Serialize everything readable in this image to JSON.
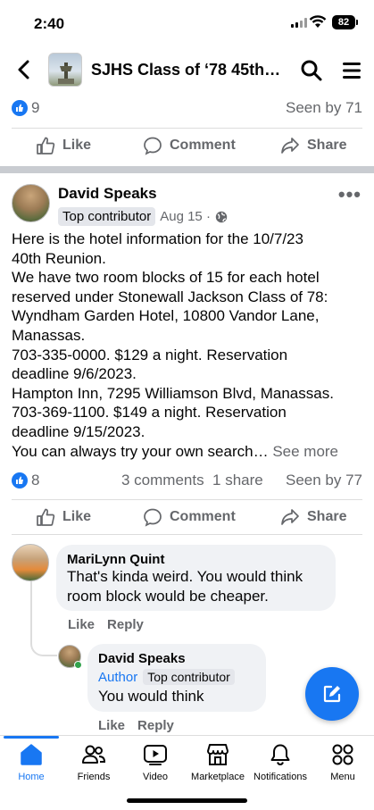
{
  "status_bar": {
    "time": "2:40",
    "battery": "82"
  },
  "header": {
    "group_title": "SJHS Class of ‘78 45th…"
  },
  "prev_post": {
    "reaction_count": "9",
    "seen_by": "Seen by 71",
    "actions": {
      "like": "Like",
      "comment": "Comment",
      "share": "Share"
    }
  },
  "post": {
    "author": "David Speaks",
    "badge": "Top contributor",
    "date": "Aug 15 ·",
    "body_lines": [
      "Here is the hotel information for the 10/7/23",
      "40th Reunion.",
      "We have two room blocks of 15 for each hotel",
      "reserved under Stonewall Jackson Class of 78:",
      "Wyndham Garden Hotel, 10800 Vandor Lane,",
      "Manassas.",
      "703-335-0000. $129 a night. Reservation",
      "deadline 9/6/2023.",
      "Hampton Inn, 7295 Williamson Blvd, Manassas.",
      "703-369-1100. $149 a night. Reservation",
      "deadline 9/15/2023."
    ],
    "last_line": "You can always try your own search…",
    "see_more": "See more",
    "reaction_count": "8",
    "comments": "3 comments",
    "shares": "1 share",
    "seen_by": "Seen by 77",
    "actions": {
      "like": "Like",
      "comment": "Comment",
      "share": "Share"
    }
  },
  "comments": [
    {
      "name": "MariLynn Quint",
      "text_lines": [
        "That's kinda weird. You would think",
        "room block would be cheaper."
      ],
      "like": "Like",
      "reply": "Reply"
    },
    {
      "name": "David Speaks",
      "author_tag": "Author",
      "badge": "Top contributor",
      "text": "You would think",
      "like": "Like",
      "reply": "Reply"
    }
  ],
  "tabs": [
    {
      "label": "Home",
      "icon": "home-icon",
      "active": true
    },
    {
      "label": "Friends",
      "icon": "friends-icon"
    },
    {
      "label": "Video",
      "icon": "video-icon"
    },
    {
      "label": "Marketplace",
      "icon": "marketplace-icon"
    },
    {
      "label": "Notifications",
      "icon": "bell-icon"
    },
    {
      "label": "Menu",
      "icon": "menu-grid-icon"
    }
  ],
  "colors": {
    "accent": "#1877f2",
    "secondary_text": "#65676b",
    "bubble": "#f0f2f5"
  }
}
